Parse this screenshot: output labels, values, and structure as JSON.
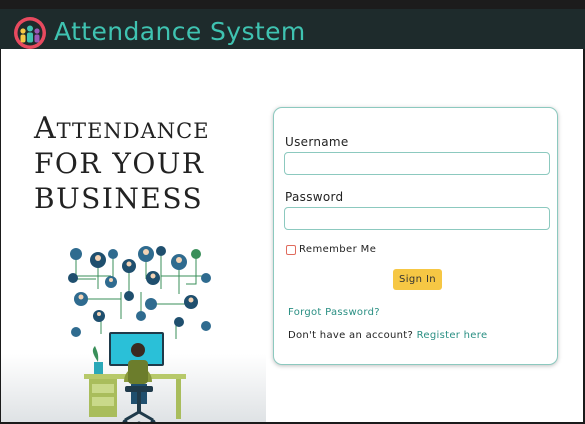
{
  "header": {
    "title": "Attendance System",
    "logo_icon": "people-group-logo-icon"
  },
  "hero": {
    "line1": "Attendance",
    "line2": "FOR YOUR",
    "line3": "BUSINESS"
  },
  "login": {
    "username_label": "Username",
    "username_value": "",
    "password_label": "Password",
    "password_value": "",
    "remember_label": "Remember Me",
    "remember_checked": false,
    "signin_label": "Sign In",
    "forgot_label": "Forgot Password?",
    "no_account_text": "Don't have an account?",
    "register_label": "Register here"
  },
  "colors": {
    "header_bg": "#1e2b2c",
    "title_teal": "#3fc3b1",
    "link_teal": "#2a8f83",
    "button_yellow": "#f6c744",
    "border_teal": "#8cc9bf"
  }
}
